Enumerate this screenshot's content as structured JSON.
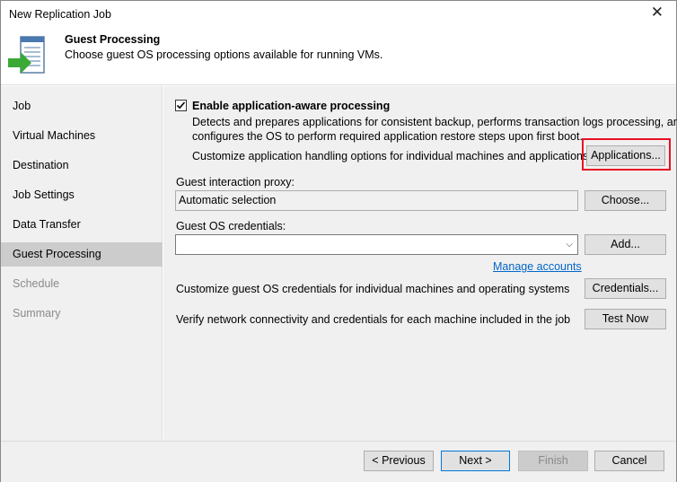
{
  "window": {
    "title": "New Replication Job",
    "close_glyph": "✕"
  },
  "header": {
    "title": "Guest Processing",
    "subtitle": "Choose guest OS processing options available for running VMs.",
    "icon": "guest-processing-icon"
  },
  "sidebar": {
    "items": [
      {
        "label": "Job",
        "state": "normal"
      },
      {
        "label": "Virtual Machines",
        "state": "normal"
      },
      {
        "label": "Destination",
        "state": "normal"
      },
      {
        "label": "Job Settings",
        "state": "normal"
      },
      {
        "label": "Data Transfer",
        "state": "normal"
      },
      {
        "label": "Guest Processing",
        "state": "active"
      },
      {
        "label": "Schedule",
        "state": "disabled"
      },
      {
        "label": "Summary",
        "state": "disabled"
      }
    ]
  },
  "main": {
    "app_aware": {
      "checked": true,
      "label": "Enable application-aware processing",
      "desc_line1": "Detects and prepares applications for consistent backup, performs transaction logs processing, and",
      "desc_line2": "configures the OS to perform required application restore steps upon first boot.",
      "customize_text": "Customize application handling options for individual machines and applications",
      "applications_button": "Applications..."
    },
    "proxy": {
      "label": "Guest interaction proxy:",
      "value": "Automatic selection",
      "choose_button": "Choose..."
    },
    "credentials": {
      "label": "Guest OS credentials:",
      "value": "",
      "add_button": "Add...",
      "manage_link": "Manage accounts",
      "customize_text": "Customize guest OS credentials for individual machines and operating systems",
      "credentials_button": "Credentials..."
    },
    "verify": {
      "text": "Verify network connectivity and credentials for each machine included in the job",
      "test_button": "Test Now"
    }
  },
  "footer": {
    "previous": "< Previous",
    "next": "Next >",
    "finish": "Finish",
    "cancel": "Cancel"
  },
  "colors": {
    "highlight": "#e81123",
    "link": "#0066cc",
    "accent": "#0078d7"
  }
}
